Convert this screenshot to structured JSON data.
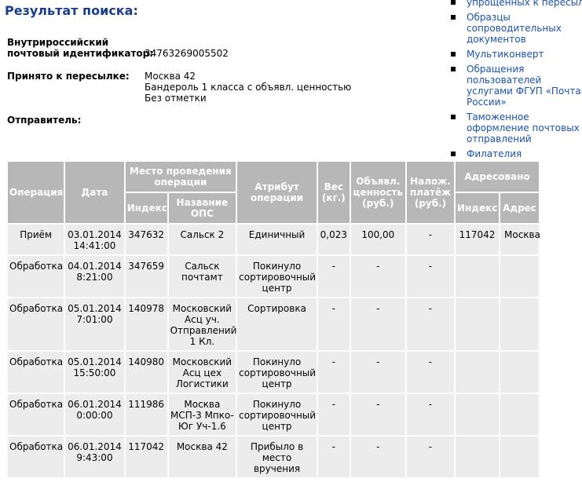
{
  "page_title": "Результат поиска:",
  "sidebar": {
    "items": [
      {
        "label": "упрощенных к пересылке"
      },
      {
        "label": "Образцы сопроводительных документов"
      },
      {
        "label": "Мультиконверт"
      },
      {
        "label": "Обращения пользователей услугами ФГУП «Почта России»"
      },
      {
        "label": "Таможенное оформление почтовых отправлений"
      },
      {
        "label": "Филателия"
      }
    ]
  },
  "details": {
    "tracking_label_line1": "Внутрироссийский",
    "tracking_label_line2": "почтовый идентификатор:",
    "tracking_number": "34763269005502",
    "accepted_label": "Принято к пересылке:",
    "accepted_line1": "Москва 42",
    "accepted_line2": "Бандероль 1 класса с объявл. ценностью",
    "accepted_line3": "Без отметки",
    "sender_label": "Отправитель:"
  },
  "table": {
    "headers": {
      "operation": "Операция",
      "date": "Дата",
      "place": "Место проведения операции",
      "index": "Индекс",
      "ops_name": "Название ОПС",
      "attribute": "Атрибут операции",
      "weight": "Вес (кг.)",
      "declared_value": "Объявл. ценность (руб.)",
      "cod": "Налож. платёж (руб.)",
      "addressed": "Адресовано",
      "addr_index": "Индекс",
      "address": "Адрес"
    },
    "rows": [
      {
        "operation": "Приём",
        "date": "03.01.2014 14:41:00",
        "index": "347632",
        "ops_name": "Сальск 2",
        "attribute": "Единичный",
        "weight": "0,023",
        "value": "100,00",
        "cod": "-",
        "addr_index": "117042",
        "address": "Москва"
      },
      {
        "operation": "Обработка",
        "date": "04.01.2014 8:21:00",
        "index": "347659",
        "ops_name": "Сальск почтамт",
        "attribute": "Покинуло сортировочный центр",
        "weight": "-",
        "value": "-",
        "cod": "-",
        "addr_index": "",
        "address": ""
      },
      {
        "operation": "Обработка",
        "date": "05.01.2014 7:01:00",
        "index": "140978",
        "ops_name": "Московский Асц уч. Отправлений 1 Кл.",
        "attribute": "Сортировка",
        "weight": "-",
        "value": "-",
        "cod": "-",
        "addr_index": "",
        "address": ""
      },
      {
        "operation": "Обработка",
        "date": "05.01.2014 15:50:00",
        "index": "140980",
        "ops_name": "Московский Асц цех Логистики",
        "attribute": "Покинуло сортировочный центр",
        "weight": "-",
        "value": "-",
        "cod": "-",
        "addr_index": "",
        "address": ""
      },
      {
        "operation": "Обработка",
        "date": "06.01.2014 0:00:00",
        "index": "111986",
        "ops_name": "Москва МСП-3 Мпко-Юг Уч-1.6",
        "attribute": "Покинуло сортировочный центр",
        "weight": "-",
        "value": "-",
        "cod": "-",
        "addr_index": "",
        "address": ""
      },
      {
        "operation": "Обработка",
        "date": "06.01.2014 9:43:00",
        "index": "117042",
        "ops_name": "Москва 42",
        "attribute": "Прибыло в место вручения",
        "weight": "-",
        "value": "-",
        "cod": "-",
        "addr_index": "",
        "address": ""
      }
    ]
  }
}
